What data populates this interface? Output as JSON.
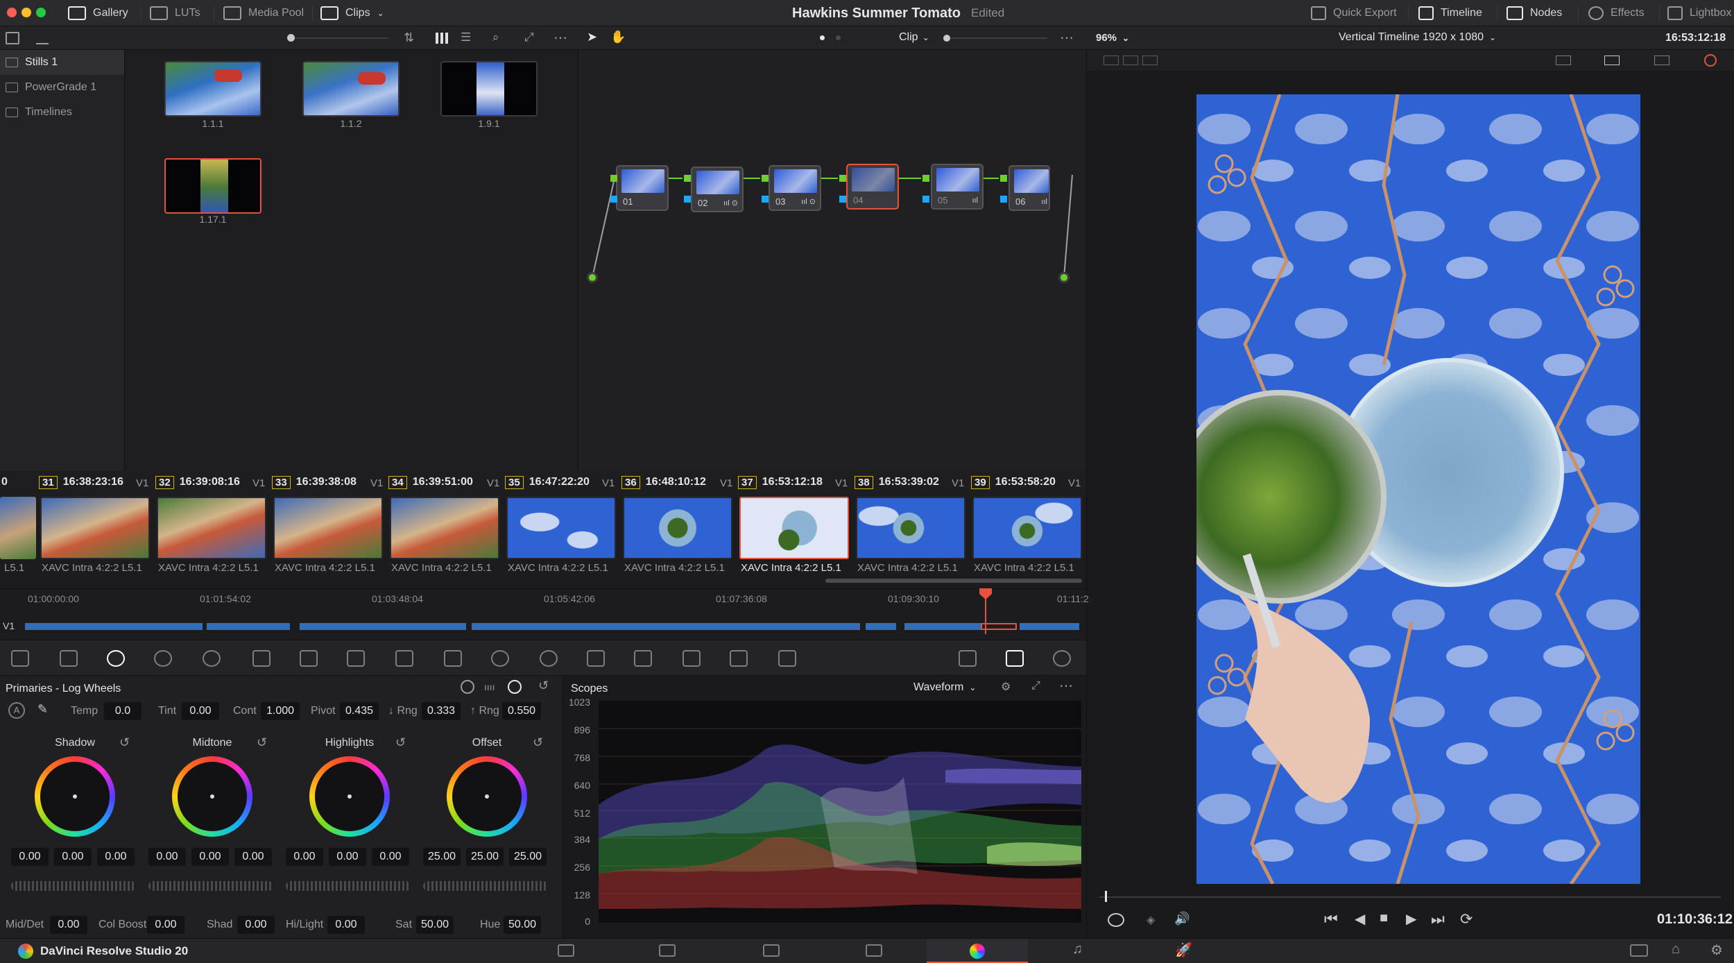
{
  "window": {
    "project_title": "Hawkins Summer Tomato",
    "status": "Edited"
  },
  "top_tabs": {
    "gallery": "Gallery",
    "luts": "LUTs",
    "media_pool": "Media Pool",
    "clips": "Clips",
    "quick_export": "Quick Export",
    "timeline": "Timeline",
    "nodes": "Nodes",
    "effects": "Effects",
    "lightbox": "Lightbox"
  },
  "node_toolbar": {
    "clip_mode": "Clip"
  },
  "viewer": {
    "zoom": "96%",
    "timeline_name": "Vertical Timeline 1920 x 1080",
    "source_timecode": "16:53:12:18",
    "record_timecode": "01:10:36:12"
  },
  "albums": [
    {
      "label": "Stills 1",
      "selected": true
    },
    {
      "label": "PowerGrade 1",
      "selected": false
    },
    {
      "label": "Timelines",
      "selected": false
    }
  ],
  "stills": [
    {
      "label": "1.1.1"
    },
    {
      "label": "1.1.2"
    },
    {
      "label": "1.9.1"
    },
    {
      "label": "1.17.1"
    }
  ],
  "nodes": [
    {
      "label": "01",
      "icons": ""
    },
    {
      "label": "02",
      "icons": "ııl ⊙"
    },
    {
      "label": "03",
      "icons": "ııl ⊙"
    },
    {
      "label": "04",
      "icons": ""
    },
    {
      "label": "05",
      "icons": "ııl"
    },
    {
      "label": "06",
      "icons": "ııl"
    }
  ],
  "clips": {
    "partial_left": {
      "num": "0",
      "label": "L5.1"
    },
    "items": [
      {
        "track": "V1",
        "num": "31",
        "timecode": "16:38:23:16",
        "codec": "XAVC Intra 4:2:2 L5.1"
      },
      {
        "track": "V1",
        "num": "32",
        "timecode": "16:39:08:16",
        "codec": "XAVC Intra 4:2:2 L5.1"
      },
      {
        "track": "V1",
        "num": "33",
        "timecode": "16:39:38:08",
        "codec": "XAVC Intra 4:2:2 L5.1"
      },
      {
        "track": "V1",
        "num": "34",
        "timecode": "16:39:51:00",
        "codec": "XAVC Intra 4:2:2 L5.1"
      },
      {
        "track": "V1",
        "num": "35",
        "timecode": "16:47:22:20",
        "codec": "XAVC Intra 4:2:2 L5.1"
      },
      {
        "track": "V1",
        "num": "36",
        "timecode": "16:48:10:12",
        "codec": "XAVC Intra 4:2:2 L5.1"
      },
      {
        "track": "V1",
        "num": "37",
        "timecode": "16:53:12:18",
        "codec": "XAVC Intra 4:2:2 L5.1"
      },
      {
        "track": "V1",
        "num": "38",
        "timecode": "16:53:39:02",
        "codec": "XAVC Intra 4:2:2 L5.1"
      },
      {
        "track": "V1",
        "num": "39",
        "timecode": "16:53:58:20",
        "codec": "XAVC Intra 4:2:2 L5.1"
      },
      {
        "track": "V1",
        "num": "",
        "timecode": "",
        "codec": ""
      }
    ]
  },
  "ruler": {
    "track": "V1",
    "ticks": [
      "01:00:00:00",
      "01:01:54:02",
      "01:03:48:04",
      "01:05:42:06",
      "01:07:36:08",
      "01:09:30:10",
      "01:11:2"
    ]
  },
  "primaries": {
    "title": "Primaries - Log Wheels",
    "temp_label": "Temp",
    "temp": "0.0",
    "tint_label": "Tint",
    "tint": "0.00",
    "cont_label": "Cont",
    "cont": "1.000",
    "pivot_label": "Pivot",
    "pivot": "0.435",
    "lrng_label": "↓ Rng",
    "lrng": "0.333",
    "hrng_label": "↑ Rng",
    "hrng": "0.550",
    "wheels": [
      {
        "name": "Shadow",
        "v1": "0.00",
        "v2": "0.00",
        "v3": "0.00"
      },
      {
        "name": "Midtone",
        "v1": "0.00",
        "v2": "0.00",
        "v3": "0.00"
      },
      {
        "name": "Highlights",
        "v1": "0.00",
        "v2": "0.00",
        "v3": "0.00"
      },
      {
        "name": "Offset",
        "v1": "25.00",
        "v2": "25.00",
        "v3": "25.00"
      }
    ],
    "middet_label": "Mid/Det",
    "middet": "0.00",
    "colboost_label": "Col Boost",
    "colboost": "0.00",
    "shad_label": "Shad",
    "shad": "0.00",
    "hilight_label": "Hi/Light",
    "hilight": "0.00",
    "sat_label": "Sat",
    "sat": "50.00",
    "hue_label": "Hue",
    "hue": "50.00"
  },
  "scopes": {
    "title": "Scopes",
    "mode": "Waveform",
    "scale": [
      "1023",
      "896",
      "768",
      "640",
      "512",
      "384",
      "256",
      "128",
      "0"
    ]
  },
  "bottom": {
    "app_name": "DaVinci Resolve Studio 20"
  },
  "colors": {
    "accent_red": "#e8513c",
    "node_green": "#6fcf2a",
    "node_blue": "#1fa6ff",
    "clip_num_border": "#d8b417",
    "track_blue": "#2f6fb8"
  }
}
